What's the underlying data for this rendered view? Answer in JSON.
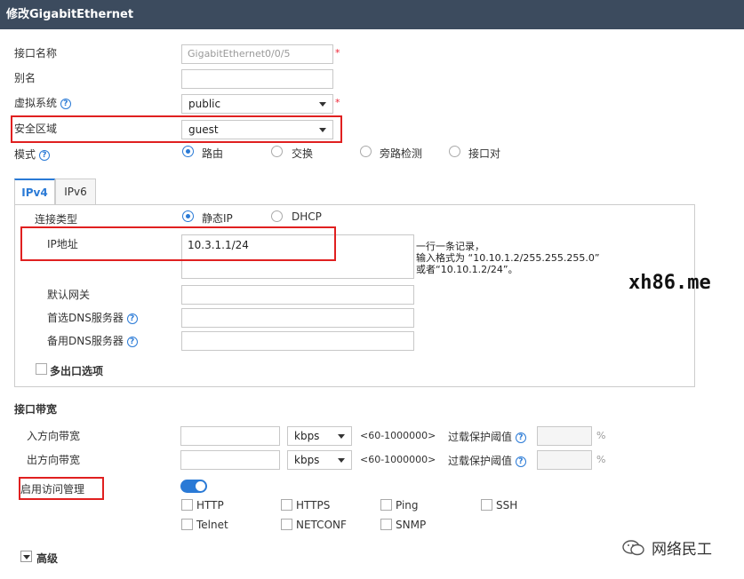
{
  "dialog": {
    "title": "修改GigabitEthernet"
  },
  "fields": {
    "interface_name": {
      "label": "接口名称",
      "value": "GigabitEthernet0/0/5"
    },
    "alias": {
      "label": "别名",
      "value": ""
    },
    "vsys": {
      "label": "虚拟系统",
      "value": "public"
    },
    "zone": {
      "label": "安全区域",
      "value": "guest"
    },
    "mode": {
      "label": "模式",
      "options": [
        "路由",
        "交换",
        "旁路检测",
        "接口对"
      ],
      "selected": "路由"
    },
    "required_mark": "*"
  },
  "tabs": [
    "IPv4",
    "IPv6"
  ],
  "ipv4": {
    "conn_type": {
      "label": "连接类型",
      "options": [
        "静态IP",
        "DHCP"
      ],
      "selected": "静态IP"
    },
    "ip": {
      "label": "IP地址",
      "value": "10.3.1.1/24"
    },
    "hint": [
      "一行一条记录，",
      "输入格式为 “10.10.1.2/255.255.255.0”",
      "或者“10.10.1.2/24”。"
    ],
    "gateway": {
      "label": "默认网关",
      "value": ""
    },
    "dns1": {
      "label": "首选DNS服务器",
      "value": ""
    },
    "dns2": {
      "label": "备用DNS服务器",
      "value": ""
    },
    "multi_exit": "多出口选项"
  },
  "bandwidth": {
    "title": "接口带宽",
    "rows": [
      {
        "label": "入方向带宽",
        "value": "",
        "unit": "kbps",
        "range": "<60-1000000>",
        "threshold_label": "过载保护阈值",
        "threshold": "",
        "pct": "%"
      },
      {
        "label": "出方向带宽",
        "value": "",
        "unit": "kbps",
        "range": "<60-1000000>",
        "threshold_label": "过载保护阈值",
        "threshold": "",
        "pct": "%"
      }
    ]
  },
  "access": {
    "label": "启用访问管理",
    "enabled": true,
    "services": [
      "HTTP",
      "HTTPS",
      "Ping",
      "SSH",
      "Telnet",
      "NETCONF",
      "SNMP"
    ]
  },
  "advanced": "高级",
  "watermarks": {
    "site": "xh86.me",
    "wechat": "网络民工"
  },
  "help_glyph": "?",
  "colors": {
    "titlebar": "#3c4b5e",
    "accent": "#2a7ad6",
    "highlight": "#e02020"
  }
}
